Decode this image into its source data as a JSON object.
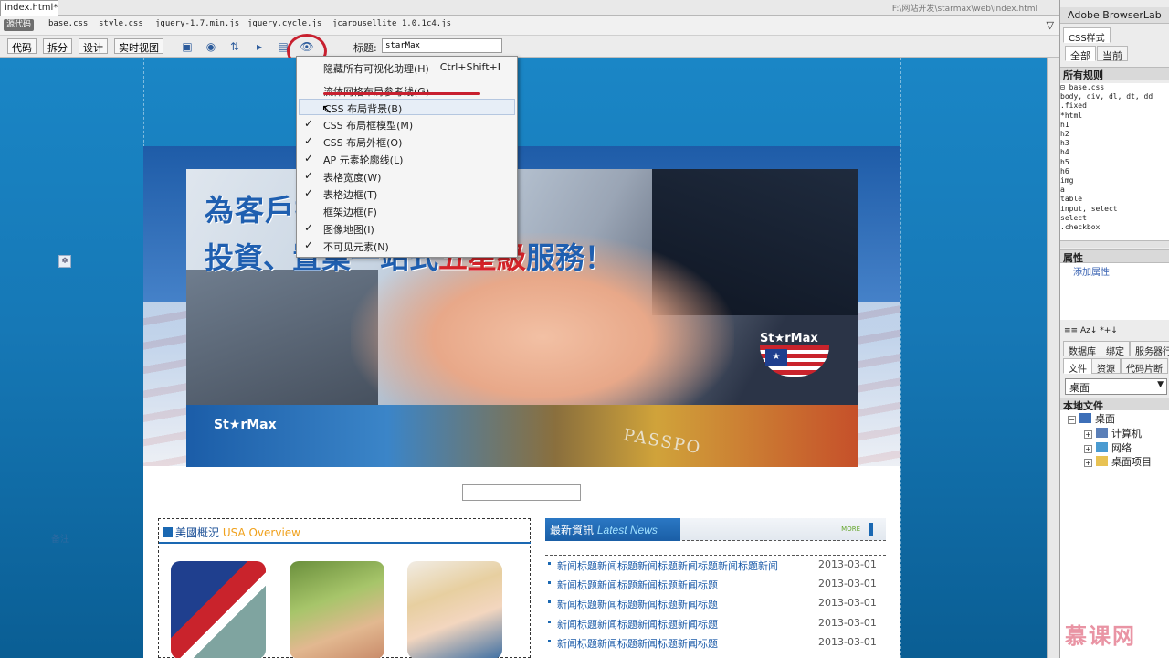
{
  "document": {
    "tab_label": "index.html*",
    "path": "F:\\网站开发\\starmax\\web\\index.html",
    "minimize_glyph": "_"
  },
  "related_files": {
    "source_badge": "源代码",
    "files": [
      "base.css",
      "style.css",
      "jquery-1.7.min.js",
      "jquery.cycle.js",
      "jcarousellite_1.0.1c4.js"
    ]
  },
  "toolbar": {
    "view_buttons": [
      "代码",
      "拆分",
      "设计",
      "实时视图"
    ],
    "title_label": "标题:",
    "title_value": "starMax",
    "icons": [
      "multiscreen-icon",
      "browser-preview-icon",
      "file-management-icon",
      "check-browser-icon",
      "validate-icon",
      "visual-aids-icon"
    ]
  },
  "visual_aids_menu": {
    "items": [
      {
        "label": "隐藏所有可视化助理(H)",
        "shortcut": "Ctrl+Shift+I",
        "checked": false
      },
      {
        "label": "流体网格布局参考线(G)",
        "shortcut": "",
        "checked": false
      },
      {
        "label": "CSS 布局背景(B)",
        "shortcut": "",
        "checked": false
      },
      {
        "label": "CSS 布局框模型(M)",
        "shortcut": "",
        "checked": true
      },
      {
        "label": "CSS 布局外框(O)",
        "shortcut": "",
        "checked": true
      },
      {
        "label": "AP 元素轮廓线(L)",
        "shortcut": "",
        "checked": true
      },
      {
        "label": "表格宽度(W)",
        "shortcut": "",
        "checked": true
      },
      {
        "label": "表格边框(T)",
        "shortcut": "",
        "checked": true
      },
      {
        "label": "框架边框(F)",
        "shortcut": "",
        "checked": false
      },
      {
        "label": "图像地图(I)",
        "shortcut": "",
        "checked": true
      },
      {
        "label": "不可见元素(N)",
        "shortcut": "",
        "checked": true
      }
    ],
    "check_glyph": "✓"
  },
  "canvas": {
    "ap_marker_glyph": "❄",
    "faint_label": "备注"
  },
  "banner": {
    "headline_line1": "為客戶提供",
    "headline_line2_a": "投資、置業",
    "headline_line2_b": "一站式",
    "headline_line2_red": "五星級",
    "headline_line2_c": "服務！",
    "logo": "St★rMax",
    "passport_text": "PASSPO"
  },
  "usa_overview": {
    "title_cn": "美國概況",
    "title_en": "USA Overview"
  },
  "latest_news": {
    "title_cn": "最新資訊",
    "title_en": "Latest News",
    "more": "MORE",
    "rows": [
      {
        "title": "新闻标题新闻标题新闻标题新闻标题新闻标题新闻",
        "date": "2013-03-01"
      },
      {
        "title": "新闻标题新闻标题新闻标题新闻标题",
        "date": "2013-03-01"
      },
      {
        "title": "新闻标题新闻标题新闻标题新闻标题",
        "date": "2013-03-01"
      },
      {
        "title": "新闻标题新闻标题新闻标题新闻标题",
        "date": "2013-03-01"
      },
      {
        "title": "新闻标题新闻标题新闻标题新闻标题",
        "date": "2013-03-01"
      }
    ]
  },
  "right_panel": {
    "browserlab_title": "Adobe BrowserLab",
    "css_tab": "CSS样式",
    "all_tab": "全部",
    "current_tab": "当前",
    "all_rules_header": "所有规则",
    "rules": [
      "⊟ base.css",
      "   body, div, dl, dt, dd",
      "   .fixed",
      "   *html",
      "   h1",
      "   h2",
      "   h3",
      "   h4",
      "   h5",
      "   h6",
      "   img",
      "   a",
      "   table",
      "   input, select",
      "   select",
      "   .checkbox"
    ],
    "properties_header": "属性",
    "add_property": "添加属性",
    "props_bar": "≡≡ Az↓ *+↓",
    "bottom_tabs_1": [
      "数据库",
      "绑定",
      "服务器行为"
    ],
    "bottom_tabs_2": [
      "文件",
      "资源",
      "代码片断"
    ],
    "drive": "桌面",
    "local_files_header": "本地文件",
    "tree": [
      {
        "label": "桌面",
        "level": 0,
        "expander": "⊟"
      },
      {
        "label": "计算机",
        "level": 1,
        "expander": "⊞"
      },
      {
        "label": "网络",
        "level": 1,
        "expander": "⊞"
      },
      {
        "label": "桌面项目",
        "level": 1,
        "expander": "⊞"
      }
    ]
  },
  "watermark": "慕课网",
  "colors": {
    "canvas_blue": "#1678b6",
    "accent_red": "#c8202f",
    "link_blue": "#1a5aa8"
  }
}
